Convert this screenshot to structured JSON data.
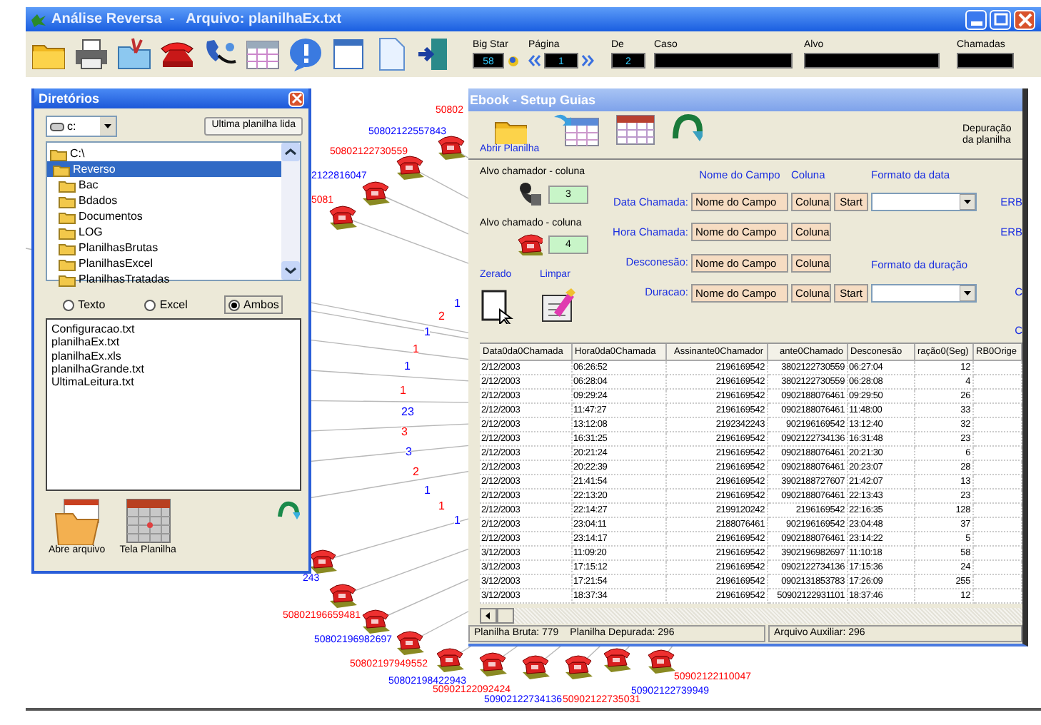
{
  "window": {
    "title": "Análise Reversa  -   Arquivo: planilhaEx.txt"
  },
  "toolbar": {
    "fields": [
      {
        "label": "Big Star",
        "value": "58"
      },
      {
        "label": "Página",
        "value": "1"
      },
      {
        "label": "De",
        "value": "2"
      },
      {
        "label": "Caso"
      },
      {
        "label": "Alvo"
      },
      {
        "label": "Chamadas"
      }
    ]
  },
  "graph": {
    "nodes": [
      {
        "number": "50802",
        "color": "#ff0000"
      },
      {
        "number": "50802122557843",
        "color": "#0000ff"
      },
      {
        "number": "50802122730559",
        "color": "#ff0000"
      },
      {
        "number": "2122816047",
        "color": "#0000ff"
      },
      {
        "number": "5081",
        "color": "#ff0000"
      },
      {
        "number": "243",
        "color": "#0000ff"
      },
      {
        "number": "50802196659481",
        "color": "#ff0000"
      },
      {
        "number": "50802196982697",
        "color": "#0000ff"
      },
      {
        "number": "50802197949552",
        "color": "#ff0000"
      },
      {
        "number": "50802198422943",
        "color": "#0000ff"
      },
      {
        "number": "50902122092424",
        "color": "#ff0000"
      },
      {
        "number": "50902122734136",
        "color": "#0000ff"
      },
      {
        "number": "50902122735031",
        "color": "#ff0000"
      },
      {
        "number": "50902122739949",
        "color": "#0000ff"
      },
      {
        "number": "50902122110047",
        "color": "#ff0000"
      }
    ],
    "edge_counts": [
      {
        "count": "1",
        "color": "#0000ff"
      },
      {
        "count": "2",
        "color": "#ff0000"
      },
      {
        "count": "1",
        "color": "#0000ff"
      },
      {
        "count": "1",
        "color": "#ff0000"
      },
      {
        "count": "1",
        "color": "#0000ff"
      },
      {
        "count": "1",
        "color": "#ff0000"
      },
      {
        "count": "23",
        "color": "#0000ff"
      },
      {
        "count": "3",
        "color": "#ff0000"
      },
      {
        "count": "3",
        "color": "#0000ff"
      },
      {
        "count": "2",
        "color": "#ff0000"
      },
      {
        "count": "1",
        "color": "#0000ff"
      },
      {
        "count": "1",
        "color": "#ff0000"
      },
      {
        "count": "1",
        "color": "#0000ff"
      }
    ]
  },
  "directories": {
    "title": "Diretórios",
    "drive": "c:",
    "last_button": "Ultima planilha lida",
    "folders": [
      {
        "name": "C:\\",
        "selected": false,
        "children": [
          {
            "name": "Reverso",
            "selected": true,
            "children": [
              {
                "name": "Bac",
                "selected": false
              },
              {
                "name": "Bdados",
                "selected": false
              },
              {
                "name": "Documentos",
                "selected": false
              },
              {
                "name": "LOG",
                "selected": false
              },
              {
                "name": "PlanilhasBrutas",
                "selected": false
              },
              {
                "name": "PlanilhasExcel",
                "selected": false
              },
              {
                "name": "PlanilhasTratadas",
                "selected": false
              }
            ]
          }
        ]
      }
    ],
    "filters": [
      {
        "label": "Texto",
        "selected": false
      },
      {
        "label": "Excel",
        "selected": false
      },
      {
        "label": "Ambos",
        "selected": true
      }
    ],
    "files": [
      "Configuracao.txt",
      "planilhaEx.txt",
      "planilhaEx.xls",
      "planilhaGrande.txt",
      "UltimaLeitura.txt"
    ],
    "actions": [
      "Abre arquivo",
      "Tela Planilha"
    ]
  },
  "setup": {
    "title": "Ebook - Setup Guias",
    "open_label": "Abrir Planilha",
    "note": [
      "Depuração",
      "da planilha"
    ],
    "caller_label": "Alvo chamador - coluna",
    "caller_column": "3",
    "called_label": "Alvo chamado - coluna",
    "called_column": "4",
    "zero_label": "Zerado",
    "clear_label": "Limpar",
    "headers": {
      "name": "Nome do Campo",
      "column": "Coluna",
      "date_format": "Formato da data",
      "duration_format": "Formato da duração"
    },
    "fields": [
      {
        "label": "Data Chamada:",
        "name": "Nome do Campo",
        "column": "Coluna",
        "start": "Start",
        "side": "ERB"
      },
      {
        "label": "Hora Chamada:",
        "name": "Nome do Campo",
        "column": "Coluna",
        "side": "ERB"
      },
      {
        "label": "Desconesão:",
        "name": "Nome do Campo",
        "column": "Coluna"
      },
      {
        "label": "Duracao:",
        "name": "Nome do Campo",
        "column": "Coluna",
        "start": "Start",
        "side": "C"
      }
    ],
    "side_extra": "C",
    "table": {
      "columns": [
        "Data0da0Chamada",
        "Hora0da0Chamada",
        "Assinante0Chamador",
        "ante0Chamado",
        "Desconesão",
        "ração0(Seg)",
        "RB0Orige"
      ],
      "rows": [
        [
          "2/12/2003",
          "06:26:52",
          "2196169542",
          "3802122730559",
          "06:27:04",
          "12"
        ],
        [
          "2/12/2003",
          "06:28:04",
          "2196169542",
          "3802122730559",
          "06:28:08",
          "4"
        ],
        [
          "2/12/2003",
          "09:29:24",
          "2196169542",
          "0902188076461",
          "09:29:50",
          "26"
        ],
        [
          "2/12/2003",
          "11:47:27",
          "2196169542",
          "0902188076461",
          "11:48:00",
          "33"
        ],
        [
          "2/12/2003",
          "13:12:08",
          "2192342243",
          "902196169542",
          "13:12:40",
          "32"
        ],
        [
          "2/12/2003",
          "16:31:25",
          "2196169542",
          "0902122734136",
          "16:31:48",
          "23"
        ],
        [
          "2/12/2003",
          "20:21:24",
          "2196169542",
          "0902188076461",
          "20:21:30",
          "6"
        ],
        [
          "2/12/2003",
          "20:22:39",
          "2196169542",
          "0902188076461",
          "20:23:07",
          "28"
        ],
        [
          "2/12/2003",
          "21:41:54",
          "2196169542",
          "3902188727607",
          "21:42:07",
          "13"
        ],
        [
          "2/12/2003",
          "22:13:20",
          "2196169542",
          "0902188076461",
          "22:13:43",
          "23"
        ],
        [
          "2/12/2003",
          "22:14:27",
          "2199120242",
          "2196169542",
          "22:16:35",
          "128"
        ],
        [
          "2/12/2003",
          "23:04:11",
          "2188076461",
          "902196169542",
          "23:04:48",
          "37"
        ],
        [
          "2/12/2003",
          "23:14:17",
          "2196169542",
          "0902188076461",
          "23:14:22",
          "5"
        ],
        [
          "3/12/2003",
          "11:09:20",
          "2196169542",
          "3902196982697",
          "11:10:18",
          "58"
        ],
        [
          "3/12/2003",
          "17:15:12",
          "2196169542",
          "0902122734136",
          "17:15:36",
          "24"
        ],
        [
          "3/12/2003",
          "17:21:54",
          "2196169542",
          "0902131853783",
          "17:26:09",
          "255"
        ],
        [
          "3/12/2003",
          "18:37:34",
          "2196169542",
          "50902122931101",
          "18:37:46",
          "12"
        ]
      ]
    },
    "status": [
      "Planilha Bruta: 779",
      "Planilha Depurada: 296",
      "Arquivo Auxiliar: 296"
    ]
  }
}
